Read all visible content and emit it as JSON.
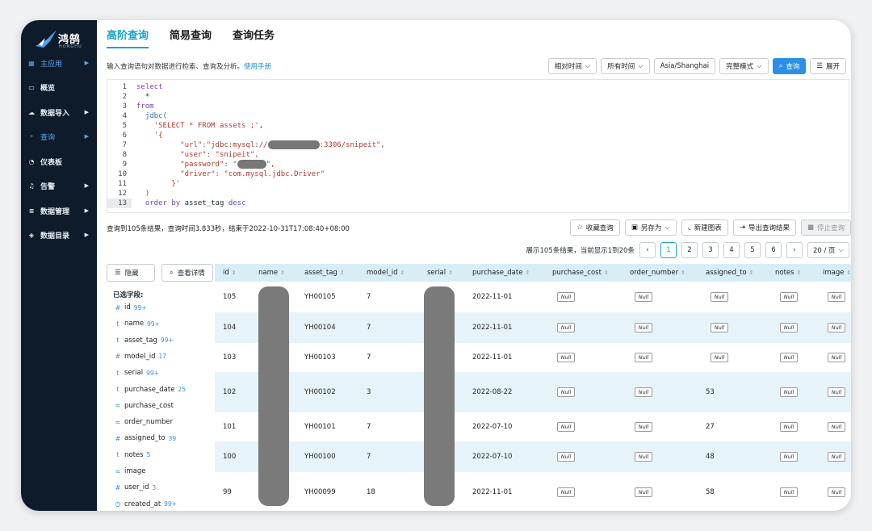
{
  "app": {
    "logo_text": "鸿鹄",
    "logo_sub": "HONGHU"
  },
  "sidebar": {
    "items": [
      {
        "label": "主应用",
        "icon": "grid-icon",
        "arrow": true,
        "active": true
      },
      {
        "label": "概览",
        "icon": "monitor-icon",
        "arrow": false
      },
      {
        "label": "数据导入",
        "icon": "cloud-icon",
        "arrow": true
      },
      {
        "label": "查询",
        "icon": "search-icon",
        "arrow": true,
        "active": true
      },
      {
        "label": "仪表板",
        "icon": "dashboard-icon",
        "arrow": false
      },
      {
        "label": "告警",
        "icon": "bell-icon",
        "arrow": true
      },
      {
        "label": "数据管理",
        "icon": "database-icon",
        "arrow": true
      },
      {
        "label": "数据目录",
        "icon": "layers-icon",
        "arrow": true
      }
    ]
  },
  "tabs": [
    {
      "label": "高阶查询",
      "active": true
    },
    {
      "label": "简易查询",
      "active": false
    },
    {
      "label": "查询任务",
      "active": false
    }
  ],
  "hint": {
    "text": "输入查询语句对数据进行检索、查询及分析。",
    "link": "使用手册"
  },
  "toolbar": {
    "relative_time": "相对时间",
    "all_time": "所有时间",
    "timezone": "Asia/Shanghai",
    "mode": "完整模式",
    "query": "查询",
    "expand": "展开"
  },
  "editor": {
    "line_numbers": [
      "1",
      "2",
      "3",
      "4",
      "5",
      "6",
      "7",
      "8",
      "9",
      "10",
      "11",
      "12",
      "13"
    ],
    "current_line": "13"
  },
  "results": {
    "summary": "查询到105条结果，查询时间3.833秒，结束于2022-10-31T17:08:40+08:00",
    "actions": {
      "save": "收藏查询",
      "save_as": "另存为",
      "new_chart": "新建图表",
      "export": "导出查询结果",
      "stop": "停止查询"
    },
    "pager": {
      "info": "展示105条结果，当前显示1到20条",
      "pages": [
        "1",
        "2",
        "3",
        "4",
        "5",
        "6"
      ],
      "page_size": "20 / 页"
    }
  },
  "fields": {
    "hide": "隐藏",
    "details": "查看详情",
    "title": "已选字段:",
    "list": [
      {
        "type": "#",
        "name": "id",
        "count": "99+"
      },
      {
        "type": "t",
        "name": "name",
        "count": "99+"
      },
      {
        "type": "t",
        "name": "asset_tag",
        "count": "99+"
      },
      {
        "type": "#",
        "name": "model_id",
        "count": "17"
      },
      {
        "type": "t",
        "name": "serial",
        "count": "99+"
      },
      {
        "type": "t",
        "name": "purchase_date",
        "count": "25"
      },
      {
        "type": "≈",
        "name": "purchase_cost",
        "count": ""
      },
      {
        "type": "≈",
        "name": "order_number",
        "count": ""
      },
      {
        "type": "#",
        "name": "assigned_to",
        "count": "39"
      },
      {
        "type": "t",
        "name": "notes",
        "count": "5"
      },
      {
        "type": "≈",
        "name": "image",
        "count": ""
      },
      {
        "type": "#",
        "name": "user_id",
        "count": "3"
      },
      {
        "type": "◷",
        "name": "created_at",
        "count": "99+"
      }
    ]
  },
  "table": {
    "columns": [
      "id",
      "name",
      "asset_tag",
      "model_id",
      "serial",
      "purchase_date",
      "purchase_cost",
      "order_number",
      "assigned_to",
      "notes",
      "image"
    ],
    "null_label": "Null",
    "rows": [
      {
        "id": "105",
        "asset_tag": "YH00105",
        "model_id": "7",
        "purchase_date": "2022-11-01",
        "assigned_to": ""
      },
      {
        "id": "104",
        "asset_tag": "YH00104",
        "model_id": "7",
        "purchase_date": "2022-11-01",
        "assigned_to": ""
      },
      {
        "id": "103",
        "asset_tag": "YH00103",
        "model_id": "7",
        "purchase_date": "2022-11-01",
        "assigned_to": ""
      },
      {
        "id": "102",
        "asset_tag": "YH00102",
        "model_id": "3",
        "purchase_date": "2022-08-22",
        "assigned_to": "53"
      },
      {
        "id": "101",
        "asset_tag": "YH00101",
        "model_id": "7",
        "purchase_date": "2022-07-10",
        "assigned_to": "27"
      },
      {
        "id": "100",
        "asset_tag": "YH00100",
        "model_id": "7",
        "purchase_date": "2022-07-10",
        "assigned_to": "48"
      },
      {
        "id": "99",
        "asset_tag": "YH00099",
        "model_id": "18",
        "purchase_date": "2022-11-01",
        "assigned_to": "58"
      }
    ]
  }
}
